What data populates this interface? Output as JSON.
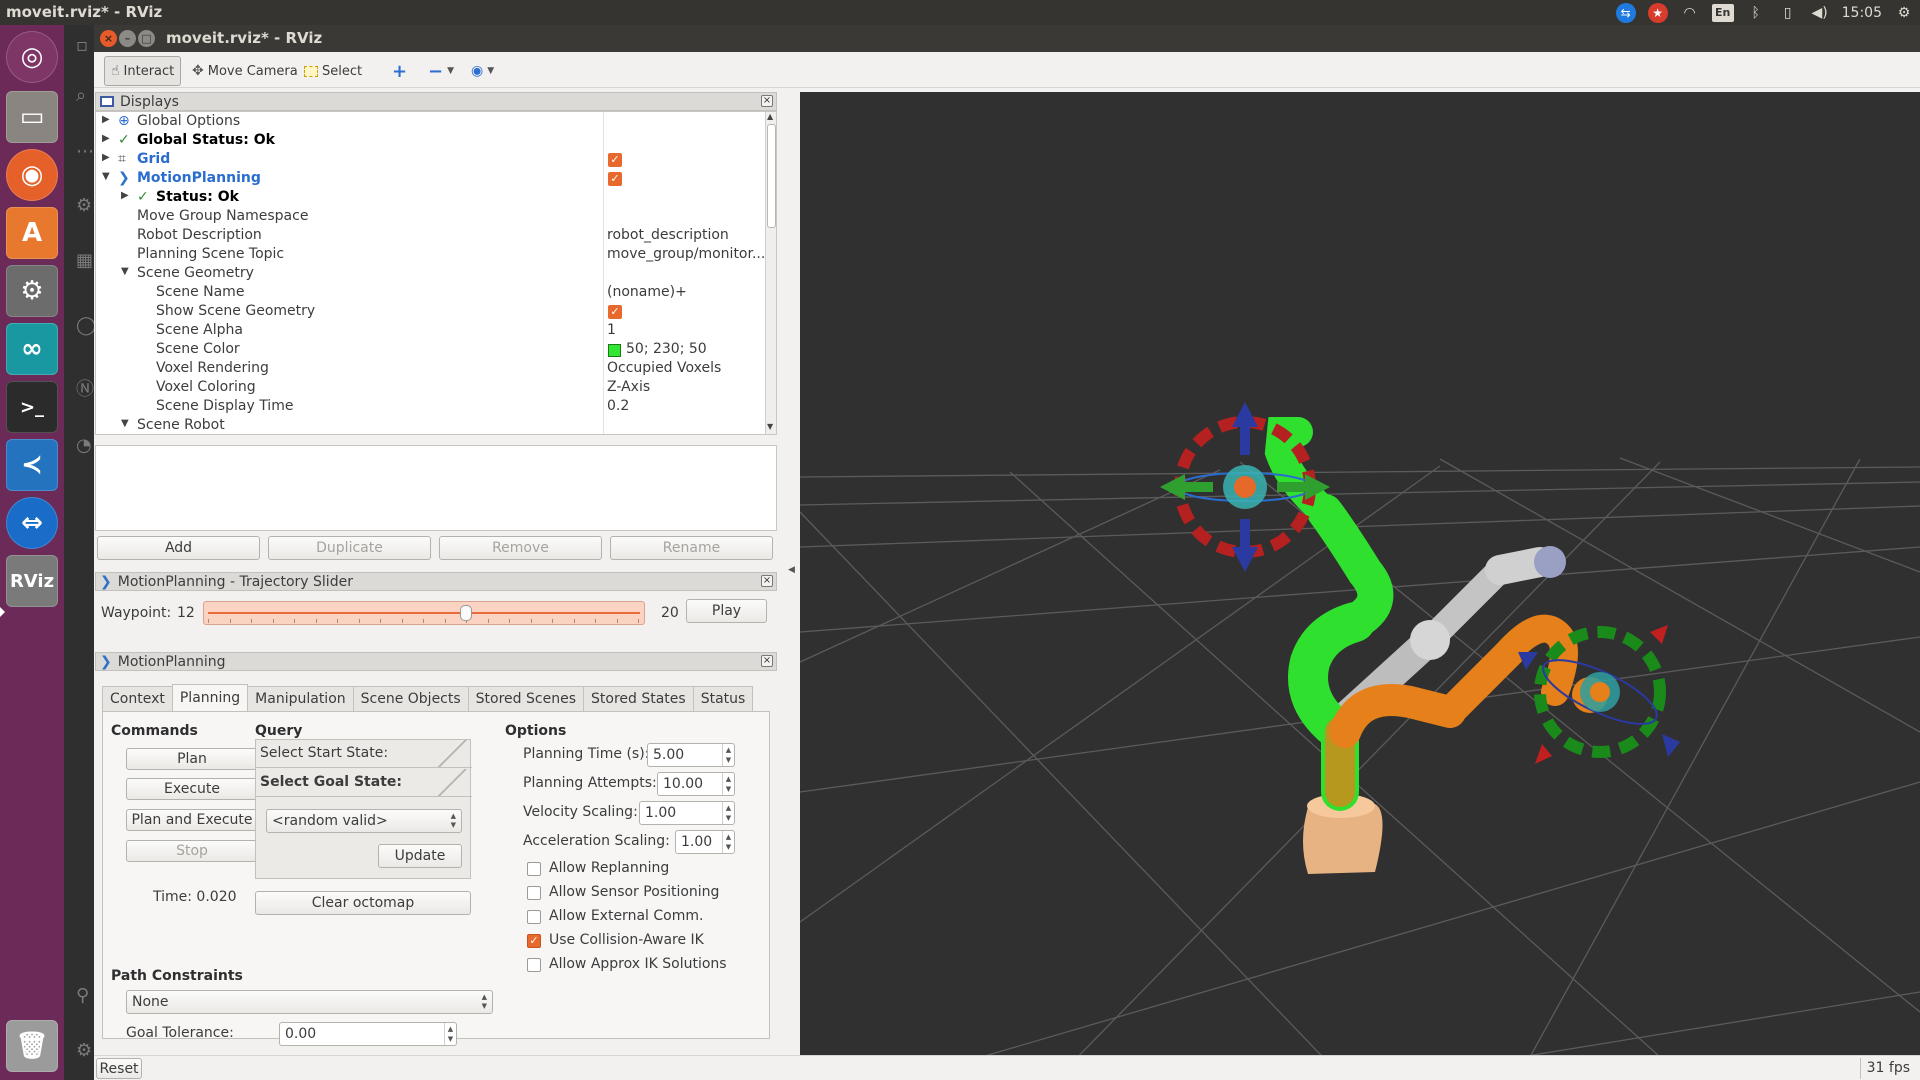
{
  "top_panel": {
    "app_title": "moveit.rviz* - RViz",
    "clock": "15:05",
    "keyboard_layout": "En"
  },
  "window": {
    "title": "moveit.rviz* - RViz"
  },
  "toolbar": {
    "interact": "Interact",
    "move_camera": "Move Camera",
    "select": "Select"
  },
  "displays": {
    "title": "Displays",
    "rows": [
      {
        "label": "Global Options",
        "value": ""
      },
      {
        "label": "Global Status: Ok",
        "value": ""
      },
      {
        "label": "Grid",
        "value": ""
      },
      {
        "label": "MotionPlanning",
        "value": ""
      },
      {
        "label": "Status: Ok",
        "value": ""
      },
      {
        "label": "Move Group Namespace",
        "value": ""
      },
      {
        "label": "Robot Description",
        "value": "robot_description"
      },
      {
        "label": "Planning Scene Topic",
        "value": "move_group/monitor..."
      },
      {
        "label": "Scene Geometry",
        "value": ""
      },
      {
        "label": "Scene Name",
        "value": "(noname)+"
      },
      {
        "label": "Show Scene Geometry",
        "value": ""
      },
      {
        "label": "Scene Alpha",
        "value": "1"
      },
      {
        "label": "Scene Color",
        "value": "50; 230; 50"
      },
      {
        "label": "Voxel Rendering",
        "value": "Occupied Voxels"
      },
      {
        "label": "Voxel Coloring",
        "value": "Z-Axis"
      },
      {
        "label": "Scene Display Time",
        "value": "0.2"
      },
      {
        "label": "Scene Robot",
        "value": ""
      }
    ],
    "scene_color_hex": "#32e632",
    "buttons": {
      "add": "Add",
      "duplicate": "Duplicate",
      "remove": "Remove",
      "rename": "Rename"
    }
  },
  "trajectory": {
    "title": "MotionPlanning - Trajectory Slider",
    "waypoint_label": "Waypoint:",
    "waypoint_value": "12",
    "waypoint_max": "20",
    "slider_fraction": 0.6,
    "play": "Play"
  },
  "motion_planning": {
    "title": "MotionPlanning",
    "tabs": [
      "Context",
      "Planning",
      "Manipulation",
      "Scene Objects",
      "Stored Scenes",
      "Stored States",
      "Status"
    ],
    "commands": {
      "heading": "Commands",
      "plan": "Plan",
      "execute": "Execute",
      "plan_and_execute": "Plan and Execute",
      "stop": "Stop",
      "time": "Time: 0.020"
    },
    "query": {
      "heading": "Query",
      "start_state": "Select Start State:",
      "goal_state": "Select Goal State:",
      "goal_option": "<random valid>",
      "update": "Update",
      "clear_octomap": "Clear octomap"
    },
    "options": {
      "heading": "Options",
      "planning_time_label": "Planning Time (s):",
      "planning_time": "5.00",
      "planning_attempts_label": "Planning Attempts:",
      "planning_attempts": "10.00",
      "velocity_label": "Velocity Scaling:",
      "velocity": "1.00",
      "accel_label": "Acceleration Scaling:",
      "accel": "1.00",
      "checkboxes": [
        {
          "label": "Allow Replanning",
          "checked": false
        },
        {
          "label": "Allow Sensor Positioning",
          "checked": false
        },
        {
          "label": "Allow External Comm.",
          "checked": false
        },
        {
          "label": "Use Collision-Aware IK",
          "checked": true
        },
        {
          "label": "Allow Approx IK Solutions",
          "checked": false
        }
      ]
    },
    "path_constraints": {
      "heading": "Path Constraints",
      "value": "None"
    },
    "goal_tolerance": {
      "label": "Goal Tolerance:",
      "value": "0.00"
    }
  },
  "statusbar": {
    "reset": "Reset",
    "fps": "31 fps"
  },
  "colors": {
    "accent_orange": "#e8692e",
    "robot_green": "#2fe02f",
    "robot_orange": "#e5801a",
    "robot_grey": "#c8c8c8",
    "viewport_bg": "#303030",
    "launcher_bg": "#6b2a58"
  }
}
